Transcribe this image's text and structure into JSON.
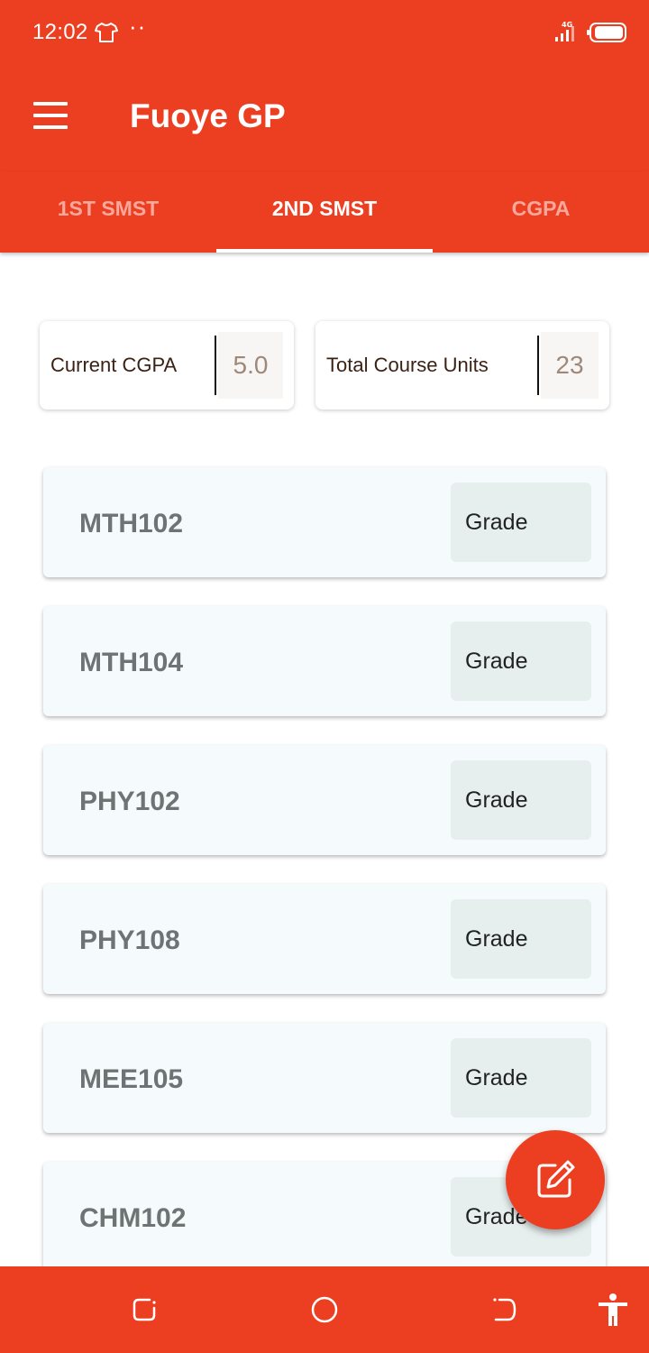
{
  "status_bar": {
    "time": "12:02",
    "network": "4G"
  },
  "app": {
    "title": "Fuoye GP"
  },
  "tabs": [
    {
      "label": "1ST SMST"
    },
    {
      "label": "2ND SMST"
    },
    {
      "label": "CGPA"
    }
  ],
  "active_tab_index": 1,
  "summary": {
    "cgpa_label": "Current CGPA",
    "cgpa_value": "5.0",
    "units_label": "Total Course Units",
    "units_value": "23"
  },
  "courses": [
    {
      "code": "MTH102",
      "grade_placeholder": "Grade"
    },
    {
      "code": "MTH104",
      "grade_placeholder": "Grade"
    },
    {
      "code": "PHY102",
      "grade_placeholder": "Grade"
    },
    {
      "code": "PHY108",
      "grade_placeholder": "Grade"
    },
    {
      "code": "MEE105",
      "grade_placeholder": "Grade"
    },
    {
      "code": "CHM102",
      "grade_placeholder": "Grade"
    }
  ],
  "colors": {
    "primary": "#ec3f22",
    "card_bg": "#f5fbfc",
    "grade_bg": "#e7efee"
  },
  "icons": {
    "menu": "menu-icon",
    "fab": "edit-icon",
    "status_shirt": "shirt-icon",
    "nav_recent": "recent-apps-icon",
    "nav_home": "home-icon",
    "nav_back": "back-icon",
    "nav_accessibility": "accessibility-icon"
  }
}
